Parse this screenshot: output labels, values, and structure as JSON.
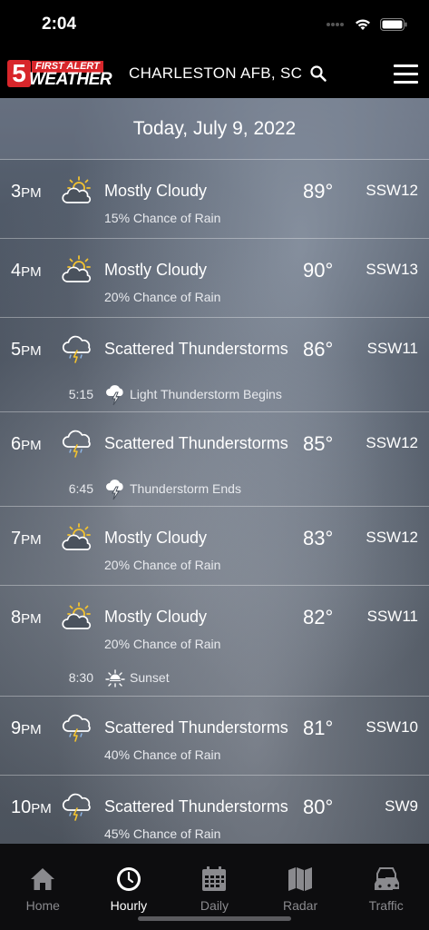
{
  "status": {
    "time": "2:04"
  },
  "header": {
    "location": "CHARLESTON AFB, SC",
    "logo_number": "5",
    "logo_top": "FIRST ALERT",
    "logo_bottom": "WEATHER"
  },
  "date": "Today, July 9, 2022",
  "rows": [
    {
      "hour": "3",
      "ampm": "PM",
      "icon": "partly-cloudy-sun-icon",
      "condition": "Mostly Cloudy",
      "temp": "89°",
      "wind": "SSW12",
      "detail": "15% Chance of Rain"
    },
    {
      "hour": "4",
      "ampm": "PM",
      "icon": "partly-cloudy-sun-icon",
      "condition": "Mostly Cloudy",
      "temp": "90°",
      "wind": "SSW13",
      "detail": "20% Chance of Rain"
    },
    {
      "hour": "5",
      "ampm": "PM",
      "icon": "thunderstorm-cloud-icon",
      "condition": "Scattered Thunderstorms",
      "temp": "86°",
      "wind": "SSW11",
      "event_time": "5:15",
      "event_text": "Light Thunderstorm Begins"
    },
    {
      "hour": "6",
      "ampm": "PM",
      "icon": "thunderstorm-cloud-icon",
      "condition": "Scattered Thunderstorms",
      "temp": "85°",
      "wind": "SSW12",
      "event_time": "6:45",
      "event_text": "Thunderstorm Ends"
    },
    {
      "hour": "7",
      "ampm": "PM",
      "icon": "partly-cloudy-sun-icon",
      "condition": "Mostly Cloudy",
      "temp": "83°",
      "wind": "SSW12",
      "detail": "20% Chance of Rain"
    },
    {
      "hour": "8",
      "ampm": "PM",
      "icon": "partly-cloudy-sun-icon",
      "condition": "Mostly Cloudy",
      "temp": "82°",
      "wind": "SSW11",
      "detail": "20% Chance of Rain",
      "event_time": "8:30",
      "event_text": "Sunset"
    },
    {
      "hour": "9",
      "ampm": "PM",
      "icon": "thunderstorm-cloud-icon",
      "condition": "Scattered Thunderstorms",
      "temp": "81°",
      "wind": "SSW10",
      "detail": "40% Chance of Rain"
    },
    {
      "hour": "10",
      "ampm": "PM",
      "icon": "thunderstorm-cloud-icon",
      "condition": "Scattered Thunderstorms",
      "temp": "80°",
      "wind": "SW9",
      "detail": "45% Chance of Rain"
    }
  ],
  "tabs": [
    {
      "label": "Home",
      "icon": "home-icon"
    },
    {
      "label": "Hourly",
      "icon": "clock-icon",
      "active": true
    },
    {
      "label": "Daily",
      "icon": "calendar-icon"
    },
    {
      "label": "Radar",
      "icon": "map-icon"
    },
    {
      "label": "Traffic",
      "icon": "traffic-icon"
    }
  ]
}
